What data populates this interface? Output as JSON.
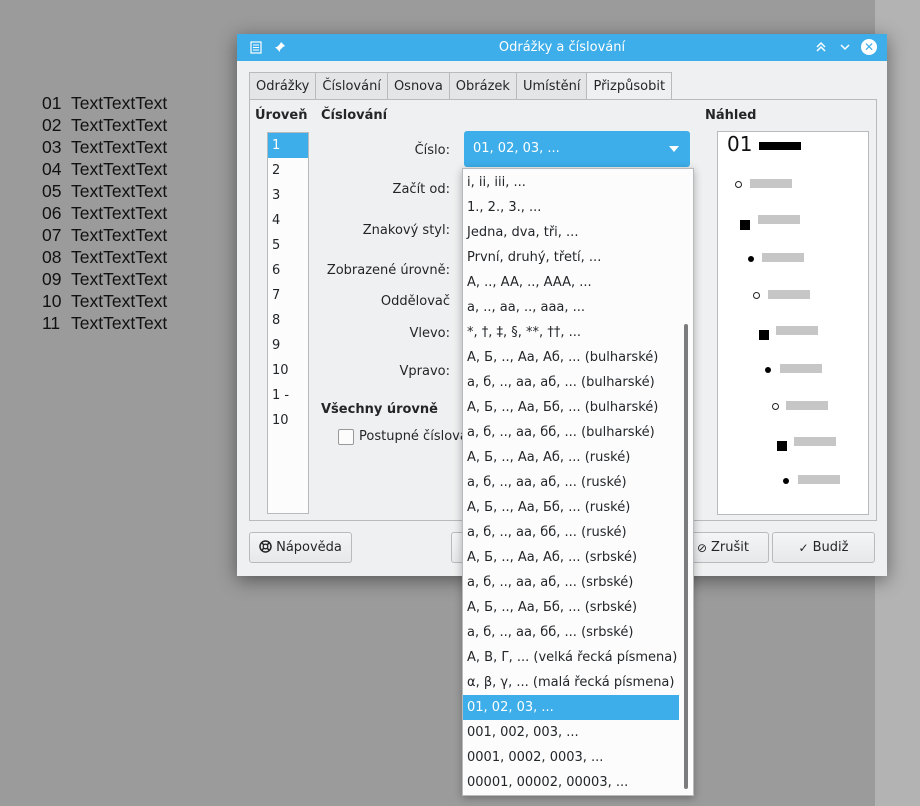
{
  "document": {
    "rows": [
      {
        "num": "01",
        "text": "TextTextText"
      },
      {
        "num": "02",
        "text": "TextTextText"
      },
      {
        "num": "03",
        "text": "TextTextText"
      },
      {
        "num": "04",
        "text": "TextTextText"
      },
      {
        "num": "05",
        "text": "TextTextText"
      },
      {
        "num": "06",
        "text": "TextTextText"
      },
      {
        "num": "07",
        "text": "TextTextText"
      },
      {
        "num": "08",
        "text": "TextTextText"
      },
      {
        "num": "09",
        "text": "TextTextText"
      },
      {
        "num": "10",
        "text": "TextTextText"
      },
      {
        "num": "11",
        "text": "TextTextText"
      }
    ]
  },
  "dialog": {
    "title": "Odrážky a číslování",
    "titlebar_icons": {
      "app": "document-icon",
      "pin": "pin-icon",
      "keep_above": "chevron-up-double-icon",
      "minimize": "chevron-down-icon",
      "close": "close-icon"
    },
    "tabs": [
      {
        "label": "Odrážky"
      },
      {
        "label": "Číslování"
      },
      {
        "label": "Osnova"
      },
      {
        "label": "Obrázek"
      },
      {
        "label": "Umístění"
      },
      {
        "label": "Přizpůsobit",
        "active": true
      }
    ],
    "level": {
      "heading": "Úroveň",
      "items": [
        "1",
        "2",
        "3",
        "4",
        "5",
        "6",
        "7",
        "8",
        "9",
        "10",
        "1 - 10"
      ],
      "selected": "1"
    },
    "numbering": {
      "heading": "Číslování",
      "number_label": "Číslo:",
      "number_value": "01, 02, 03, ...",
      "start_label": "Začít od:",
      "char_style_label": "Znakový styl:",
      "shown_levels_label": "Zobrazené úrovně:",
      "separator_label": "Oddělovač",
      "left_label": "Vlevo:",
      "right_label": "Vpravo:"
    },
    "all_levels": {
      "heading": "Všechny úrovně",
      "consecutive_label": "Postupné číslová"
    },
    "preview": {
      "heading": "Náhled",
      "first_number": "01"
    },
    "buttons": {
      "help": "Nápověda",
      "cancel": "Zrušit",
      "ok": "Budiž"
    }
  },
  "dropdown": {
    "selected": "01, 02, 03, ...",
    "items": [
      "i, ii, iii, ...",
      "1., 2., 3., ...",
      "Jedna, dva, tři, ...",
      "První, druhý, třetí, ...",
      "A, .., AA, .., AAA, ...",
      "a, .., aa, .., aaa, ...",
      "*, †, ‡, §, **, ††, ...",
      "А, Б, .., Аа, Аб, ... (bulharské)",
      "а, б, .., аа, аб, ... (bulharské)",
      "А, Б, .., Аа, Бб, ... (bulharské)",
      "а, б, .., аа, бб, ... (bulharské)",
      "А, Б, .., Аа, Аб, ... (ruské)",
      "а, б, .., аа, аб, ... (ruské)",
      "А, Б, .., Аа, Бб, ... (ruské)",
      "а, б, .., аа, бб, ... (ruské)",
      "А, Б, .., Аа, Аб, ... (srbské)",
      "а, б, .., аа, аб, ... (srbské)",
      "А, Б, .., Аа, Бб, ... (srbské)",
      "а, б, .., аа, бб, ... (srbské)",
      "Α, Β, Γ, ... (velká řecká písmena)",
      "α, β, γ, ... (malá řecká písmena)",
      "01, 02, 03, ...",
      "001, 002, 003, ...",
      "0001, 0002, 0003, ...",
      "00001, 00002, 00003, ..."
    ]
  }
}
